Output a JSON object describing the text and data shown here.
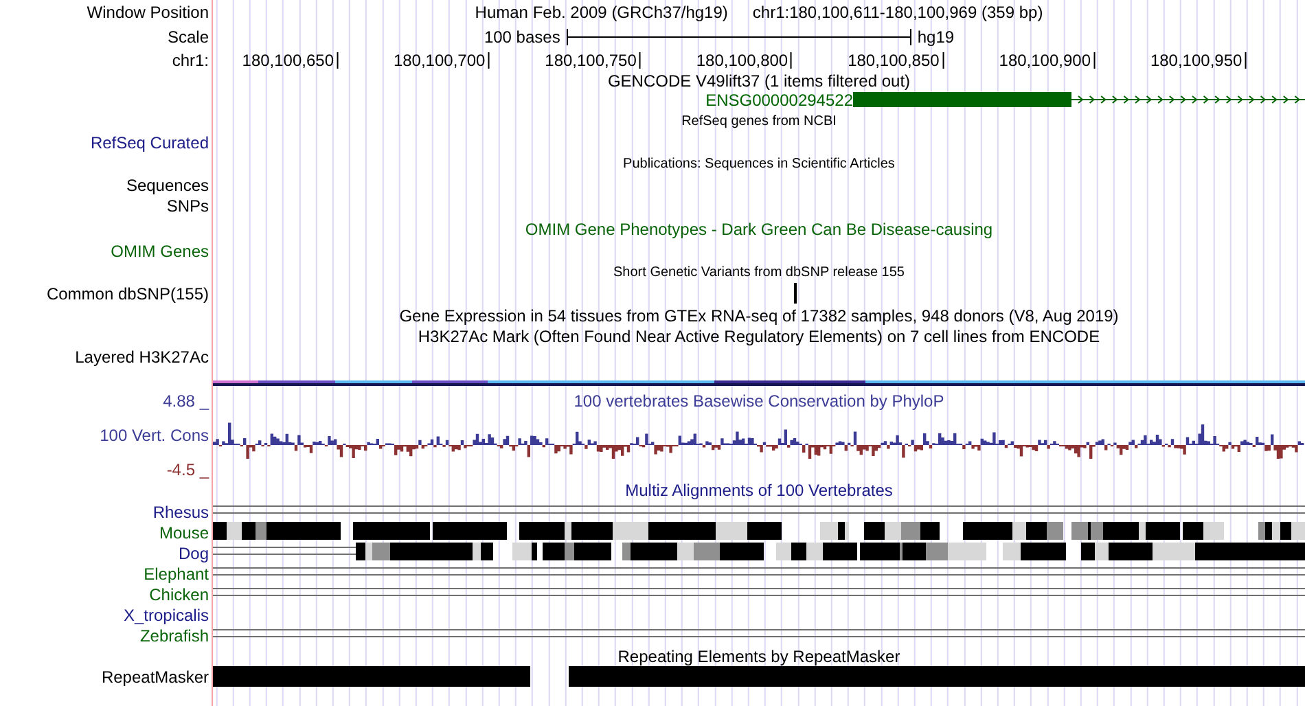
{
  "header": {
    "position_label": "Window Position",
    "assembly": "Human Feb. 2009 (GRCh37/hg19)",
    "position": "chr1:180,100,611-180,100,969 (359 bp)",
    "scale_label": "Scale",
    "scale_text": "100 bases",
    "scale_db": "hg19",
    "chrom_label": "chr1:",
    "ticks": [
      "180,100,650",
      "180,100,700",
      "180,100,750",
      "180,100,800",
      "180,100,850",
      "180,100,900",
      "180,100,950"
    ]
  },
  "tracks": [
    {
      "kind": "gene",
      "title": "GENCODE V49lift37 (1 items filtered out)",
      "gene": "ENSG00000294522",
      "color": "#006400"
    },
    {
      "kind": "compact",
      "title": "RefSeq genes from NCBI",
      "labels": [
        "RefSeq Curated"
      ],
      "color": "#1c1c88"
    },
    {
      "kind": "compact",
      "title": "Publications: Sequences in Scientific Articles",
      "labels": [
        "Sequences",
        "SNPs"
      ],
      "color": "#000000"
    },
    {
      "kind": "full",
      "title": "OMIM Gene Phenotypes - Dark Green Can Be Disease-causing",
      "labels": [
        "OMIM Genes"
      ],
      "color": "#0a640a"
    },
    {
      "kind": "snp",
      "title": "Short Genetic Variants from dbSNP release 155",
      "labels": [
        "Common dbSNP(155)"
      ],
      "color": "#000000"
    },
    {
      "kind": "title",
      "title": "Gene Expression in 54 tissues from GTEx RNA-seq of 17382 samples, 948 donors (V8, Aug 2019)",
      "color": "#000000"
    },
    {
      "kind": "layered",
      "title": "H3K27Ac Mark (Often Found Near Active Regulatory Elements) on 7 cell lines from ENCODE",
      "labels": [
        "Layered H3K27Ac"
      ],
      "color": "#000000"
    },
    {
      "kind": "wiggle",
      "title": "100 vertebrates Basewise Conservation by PhyloP",
      "name": "100 Vert. Cons",
      "color": "#3c3c96",
      "axis_labels": [
        {
          "text": "4.88 _",
          "color": "#3c3c96"
        },
        {
          "text": "-4.5 _",
          "color": "#8c3232"
        }
      ]
    },
    {
      "kind": "multiz",
      "title": "Multiz Alignments of 100 Vertebrates",
      "color": "#1c1c88",
      "species": [
        {
          "name": "Rhesus",
          "kind": "lines",
          "color": "#1c1c88"
        },
        {
          "name": "Mouse",
          "kind": "blocks",
          "color": "#0a640a"
        },
        {
          "name": "Dog",
          "kind": "partial",
          "color": "#1c1c88"
        },
        {
          "name": "Elephant",
          "kind": "lines",
          "color": "#0a640a"
        },
        {
          "name": "Chicken",
          "kind": "lines",
          "color": "#0a640a"
        },
        {
          "name": "X_tropicalis",
          "kind": "empty",
          "color": "#1c1c88"
        },
        {
          "name": "Zebrafish",
          "kind": "lines",
          "color": "#0a640a"
        }
      ]
    },
    {
      "kind": "repeat",
      "title": "Repeating Elements by RepeatMasker",
      "labels": [
        "RepeatMasker"
      ],
      "color": "#000000"
    }
  ]
}
